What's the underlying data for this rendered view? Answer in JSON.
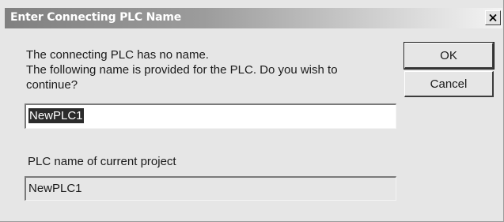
{
  "window": {
    "title": "Enter Connecting PLC Name"
  },
  "message": {
    "lines": [
      "The connecting PLC has no name.",
      "The following name is provided for the PLC. Do you wish to",
      "continue?"
    ]
  },
  "buttons": {
    "ok_label": "OK",
    "cancel_label": "Cancel"
  },
  "plc_name_input": {
    "value": "NewPLC1"
  },
  "current_project": {
    "label": "PLC name of current project",
    "value": "NewPLC1"
  },
  "icons": {
    "close": "close-icon"
  }
}
